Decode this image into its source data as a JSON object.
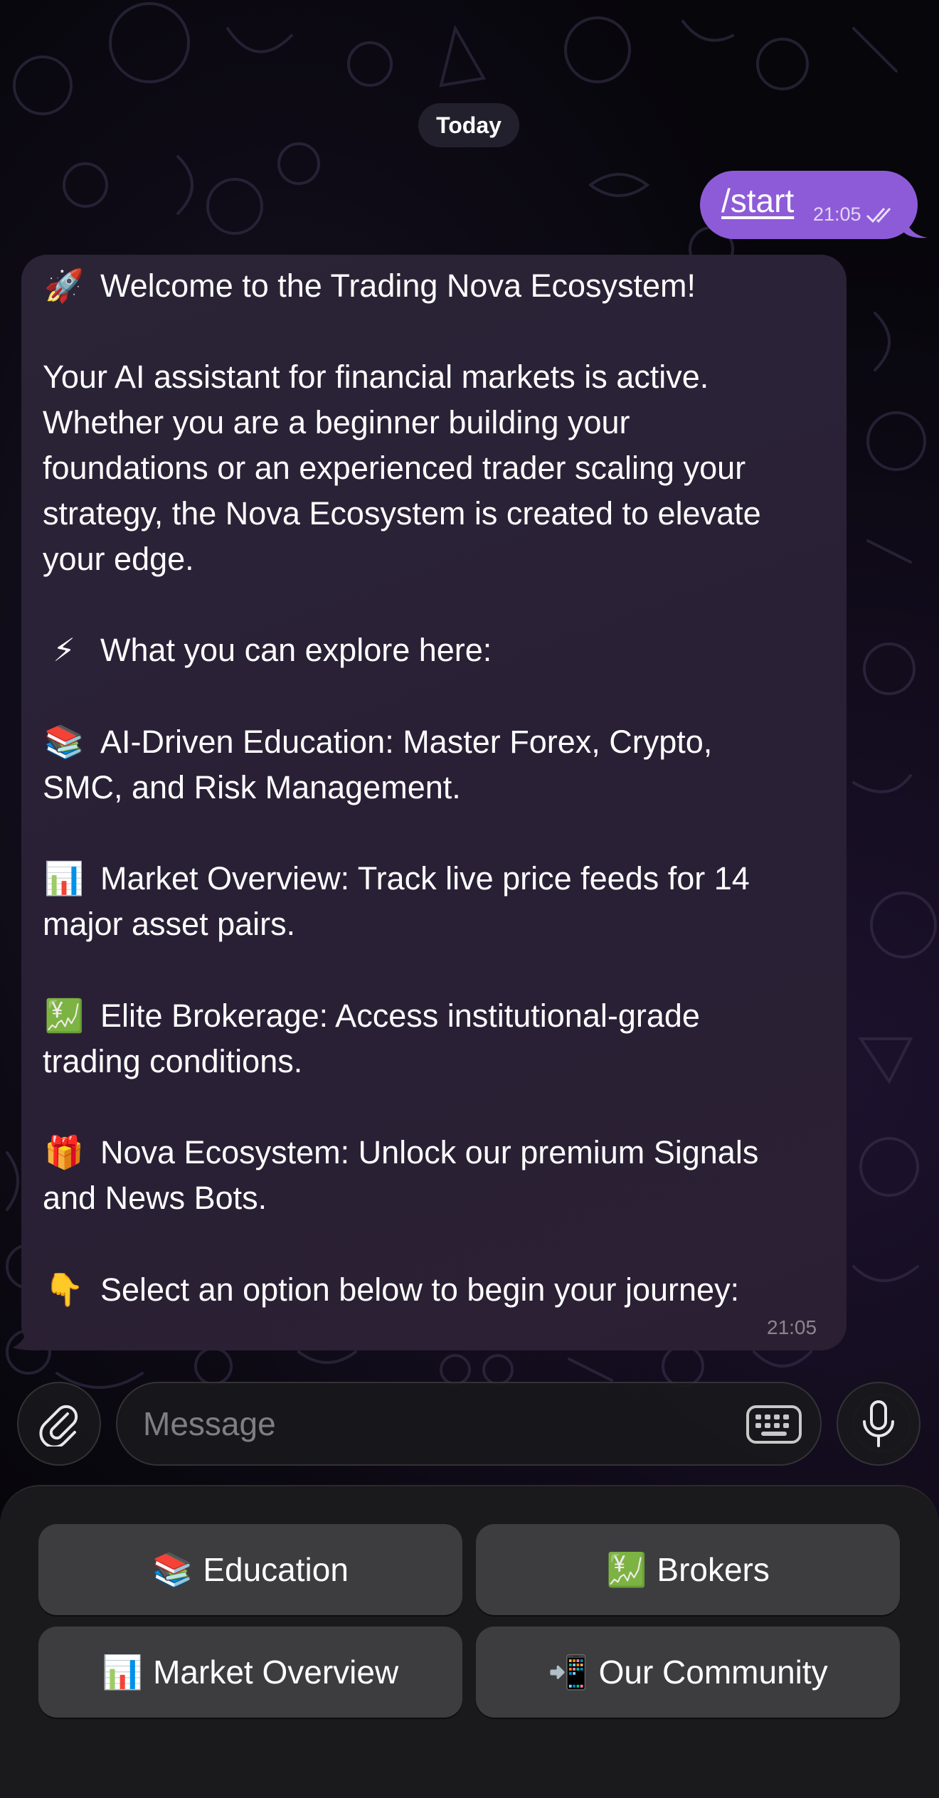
{
  "chat": {
    "date_label": "Today",
    "outgoing": {
      "text": "/start",
      "time": "21:05",
      "status_icon": "double-check-icon"
    },
    "incoming": {
      "time": "21:05",
      "lines": [
        {
          "emoji": "🚀",
          "text": "Welcome to the Trading Nova Ecosystem!"
        },
        {
          "emoji": "",
          "text": "Your AI assistant for financial markets is active."
        },
        {
          "emoji": "",
          "text": "Whether you are a beginner building your"
        },
        {
          "emoji": "",
          "text": "foundations or an experienced trader scaling your"
        },
        {
          "emoji": "",
          "text": "strategy, the Nova Ecosystem is created to elevate"
        },
        {
          "emoji": "",
          "text": "your edge."
        },
        {
          "emoji": "⚡",
          "text": "What you can explore here:"
        },
        {
          "emoji": "📚",
          "text": "AI-Driven Education: Master Forex, Crypto,"
        },
        {
          "emoji": "",
          "text": "SMC, and Risk Management."
        },
        {
          "emoji": "📊",
          "text": "Market Overview: Track live price feeds for 14"
        },
        {
          "emoji": "",
          "text": "major asset pairs."
        },
        {
          "emoji": "💹",
          "text": "Elite Brokerage: Access institutional-grade"
        },
        {
          "emoji": "",
          "text": "trading conditions."
        },
        {
          "emoji": "🎁",
          "text": "Nova Ecosystem: Unlock our premium Signals"
        },
        {
          "emoji": "",
          "text": "and News Bots."
        },
        {
          "emoji": "👇",
          "text": "Select an option below to begin your journey:"
        }
      ]
    }
  },
  "composer": {
    "placeholder": "Message",
    "attach_icon": "paperclip-icon",
    "keyboard_icon": "keyboard-icon",
    "mic_icon": "microphone-icon"
  },
  "reply_keyboard": [
    {
      "emoji": "📚",
      "label": "Education"
    },
    {
      "emoji": "💹",
      "label": "Brokers"
    },
    {
      "emoji": "📊",
      "label": "Market Overview"
    },
    {
      "emoji": "📲",
      "label": "Our Community"
    }
  ],
  "colors": {
    "outgoing_bubble": "#8e5bd8",
    "incoming_bubble": "#2a2436",
    "keyboard_button": "#3d3d40"
  }
}
